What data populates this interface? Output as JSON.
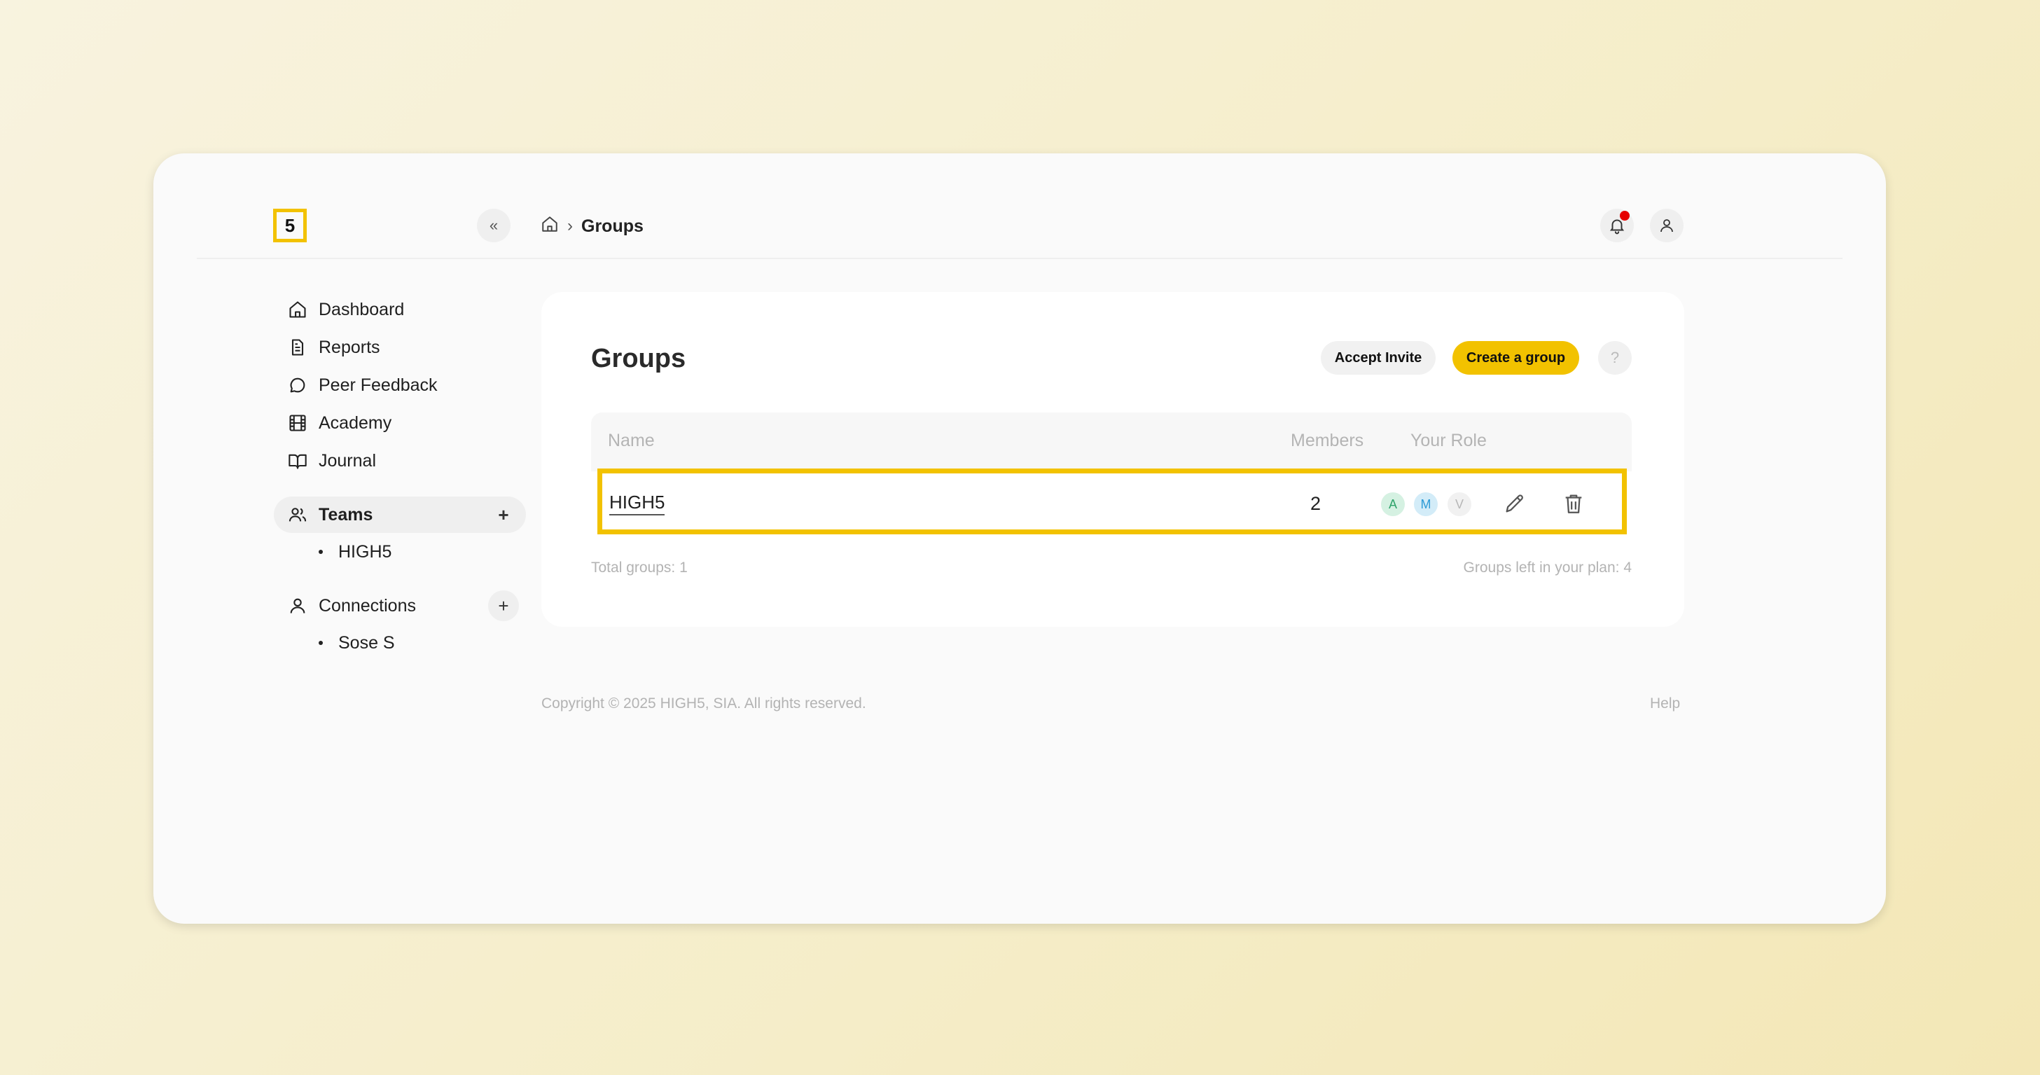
{
  "logo": {
    "text": "5"
  },
  "collapse": {
    "label": "«"
  },
  "breadcrumb": {
    "separator": "›",
    "current": "Groups"
  },
  "sidebar": {
    "items": [
      {
        "label": "Dashboard",
        "icon": "home-icon"
      },
      {
        "label": "Reports",
        "icon": "document-icon"
      },
      {
        "label": "Peer Feedback",
        "icon": "chat-bubble-icon"
      },
      {
        "label": "Academy",
        "icon": "film-icon"
      },
      {
        "label": "Journal",
        "icon": "book-icon"
      }
    ],
    "teams": {
      "label": "Teams",
      "add": "+",
      "children": [
        "HIGH5"
      ]
    },
    "connections": {
      "label": "Connections",
      "add": "+",
      "children": [
        "Sose S"
      ]
    }
  },
  "groups": {
    "title": "Groups",
    "accept_invite_label": "Accept Invite",
    "create_group_label": "Create a group",
    "help_label": "?",
    "columns": {
      "name": "Name",
      "members": "Members",
      "role": "Your Role"
    },
    "rows": [
      {
        "name": "HIGH5",
        "members": "2",
        "roles": [
          "A",
          "M",
          "V"
        ]
      }
    ],
    "total_label": "Total groups: 1",
    "left_label": "Groups left in your plan: 4"
  },
  "footer": {
    "copyright": "Copyright © 2025 HIGH5, SIA. All rights reserved.",
    "help": "Help"
  },
  "colors": {
    "accent": "#f2c200",
    "notification": "#e60000",
    "role_admin": "#2ea36a",
    "role_member": "#2d9bd6"
  }
}
